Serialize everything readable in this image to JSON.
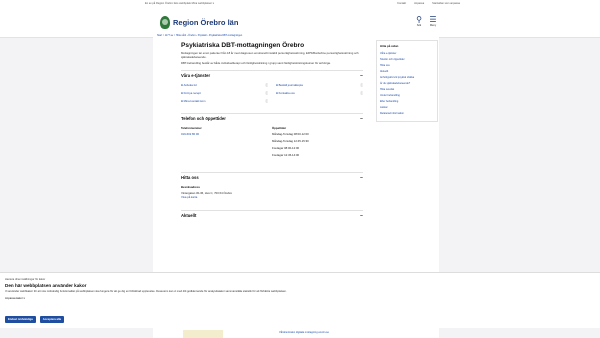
{
  "topbar": {
    "text": "En av på Region Örebro läns webbplats",
    "select": "Mina webbplatser ▾",
    "kontakt": "Kontakt",
    "anpassa": "Anpassa",
    "logout": "Startsidan som anpassa"
  },
  "header": {
    "logo": "Region Örebro län",
    "search_label": "Sök",
    "menu_label": "Meny"
  },
  "breadcrumb": "Start > 1177.se > Hitta vård › Örebro › Psykiatri › Psykiatriska DBT-mottagningen",
  "page": {
    "title": "Psykiatriska DBT-mottagningen Örebro",
    "lead1": "Mottagningen tar emot patienter från 18 år med diagnosen emotionellt instabil personlighetsstörning, EIPS/Borderline personlighetsstörning och självskadebeteende.",
    "lead2": "DBT-behandling består av både individuellterapi och färdighetsträning i grupp samt färdighetsträningskurser för anhöriga."
  },
  "sections": {
    "eservices": {
      "title": "Våra e-tjänster",
      "items": [
        {
          "label": "Avboka tid"
        },
        {
          "label": "Beställ journalkopia"
        },
        {
          "label": "Förnya recept"
        },
        {
          "label": "Kontakta oss"
        },
        {
          "label": "Mina kontakt kom"
        }
      ]
    },
    "contact": {
      "title": "Telefon och öppettider",
      "phone_label": "Telefonnummer",
      "phone": "019-602 80 00",
      "hours_label": "Öppettider",
      "hours": [
        "Måndag-Torsdag 08:00-12:00",
        "Måndag-Torsdag 12:45-15:30",
        "Fredagar 08:00-12:00",
        "Fredagar 12:45-14:00"
      ]
    },
    "find": {
      "title": "Hitta oss",
      "visit_label": "Besöksadress",
      "address": "Vintergatan 30-36, Hus C, 703 64 Örebro",
      "map_link": "Visa på karta"
    },
    "current": {
      "title": "Aktuellt"
    }
  },
  "aside": {
    "title": "Hitta på sidan",
    "links": [
      "Våra e-tjänster",
      "Telefon och öppettider",
      "Hitta oss",
      "Aktuellt",
      "Anhörigstöd vid psykisk ohälsa",
      "Är du självskadebeteende?",
      "Hitta resultat",
      "Under behandling",
      "Efter behandling",
      "Länkar",
      "Relaterad information"
    ]
  },
  "cookie": {
    "small": "Hantera dina inställningar för kakor",
    "title": "Den här webbplatsen använder kakor",
    "text": "Vi använder webbkakor för att viss nödvändig funktionalitet på webbplatsen ska fungera för att ge dig en förbättrad upplevelse. Dessutom kan vi med ditt godkännande för analysdatakor sammanställa statistik för att förbättra webbplatsen.",
    "adjust": "Anpassa kakor ▾",
    "btn_necessary": "Endast nödvändiga",
    "btn_accept": "Acceptera alla"
  },
  "footer_link": "Vårdcentralen digitala mottagning enolm.se"
}
